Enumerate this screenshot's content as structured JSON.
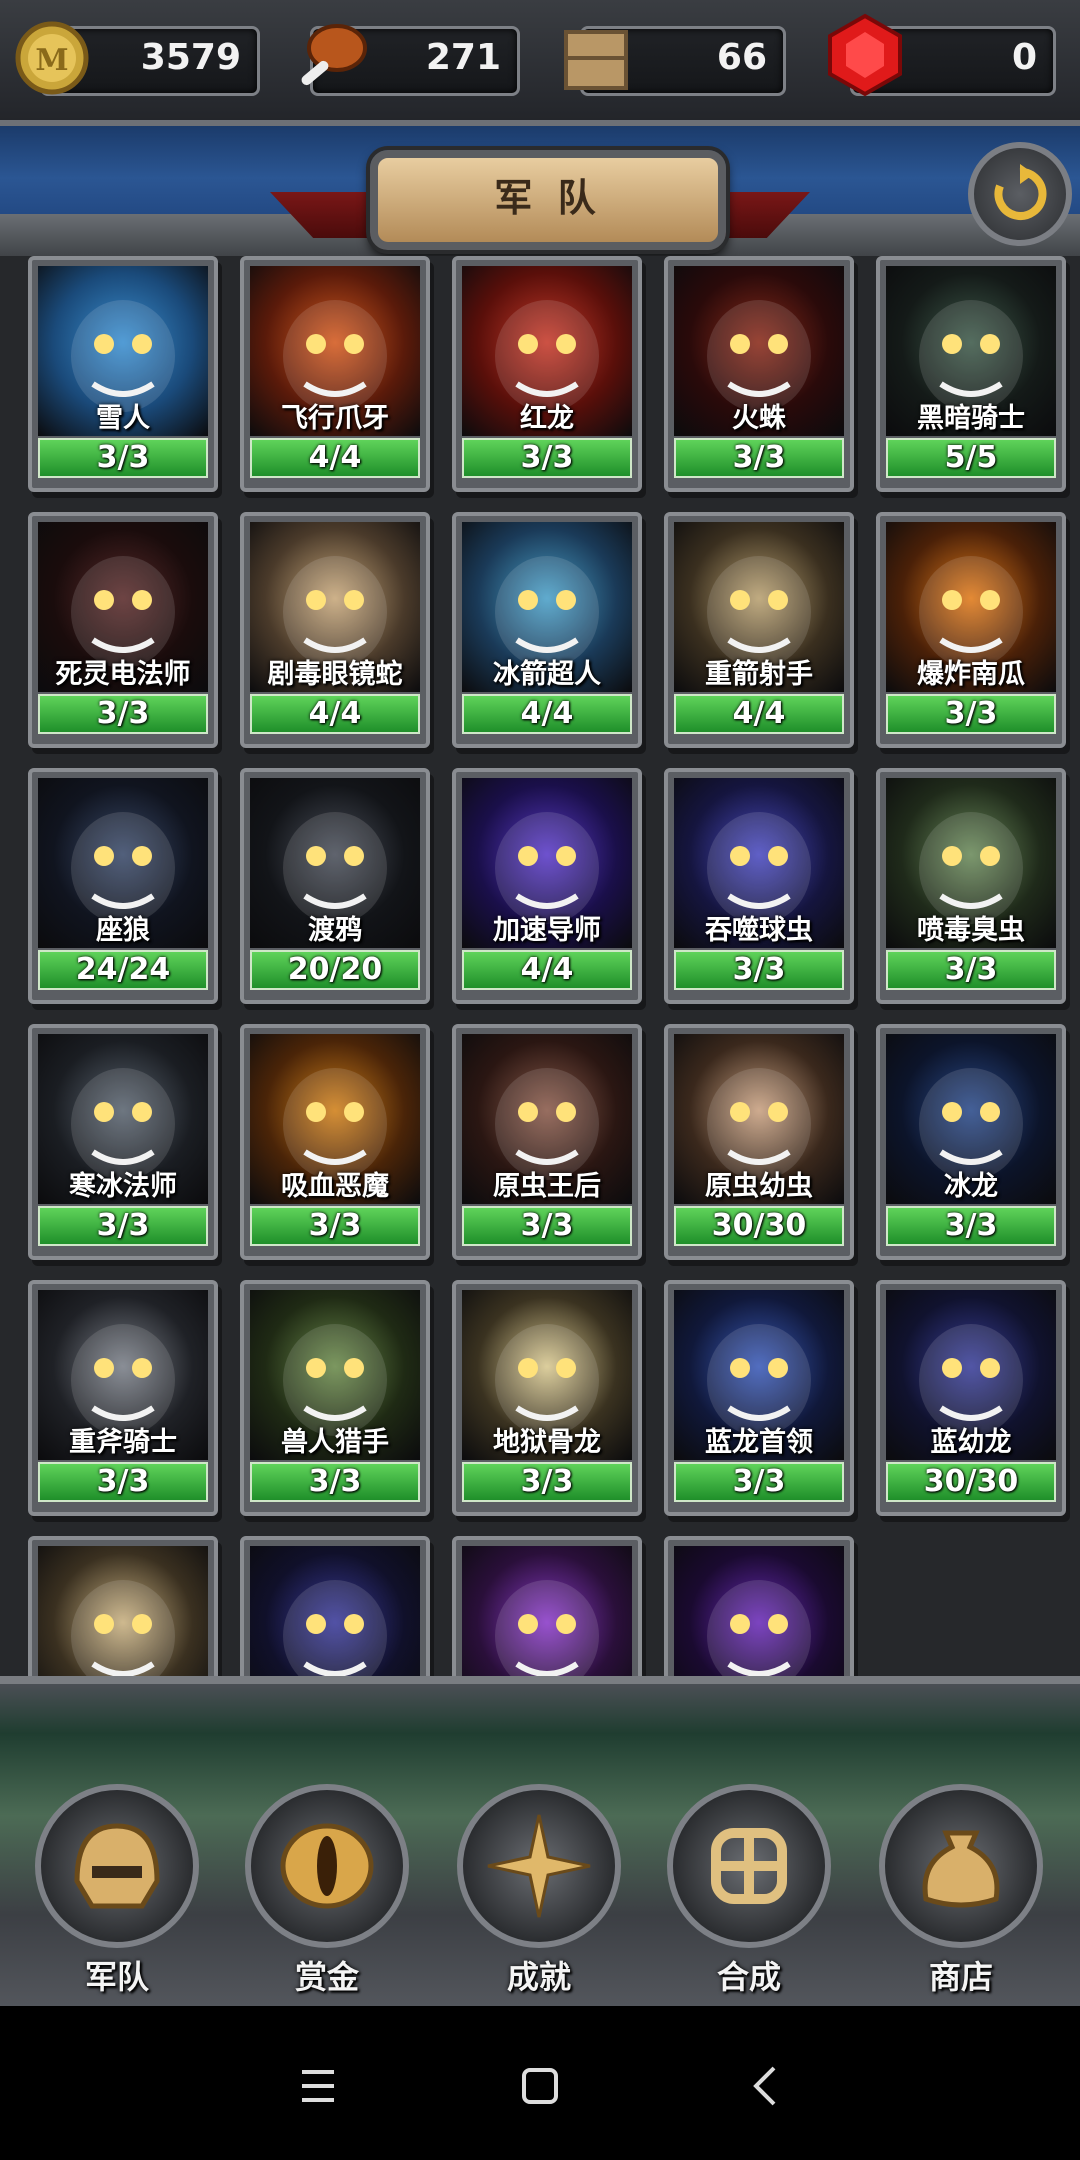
{
  "resources": {
    "gold": "3579",
    "food": "271",
    "crates": "66",
    "gems": "0"
  },
  "header": {
    "title": "军 队"
  },
  "units": [
    {
      "name": "雪人",
      "count": "3/3",
      "c1": "#3b8fd0",
      "c2": "#1a4a7a"
    },
    {
      "name": "飞行爪牙",
      "count": "4/4",
      "c1": "#d45a1f",
      "c2": "#5a1a0a"
    },
    {
      "name": "红龙",
      "count": "3/3",
      "c1": "#c63a2a",
      "c2": "#5a0f0a"
    },
    {
      "name": "火蛛",
      "count": "3/3",
      "c1": "#8a2a1a",
      "c2": "#2a0a0a"
    },
    {
      "name": "黑暗骑士",
      "count": "5/5",
      "c1": "#3e5a4a",
      "c2": "#141a18"
    },
    {
      "name": "死灵电法师",
      "count": "3/3",
      "c1": "#5a2a2a",
      "c2": "#1a0c0c"
    },
    {
      "name": "剧毒眼镜蛇",
      "count": "4/4",
      "c1": "#c7a77a",
      "c2": "#4a3a2a"
    },
    {
      "name": "冰箭超人",
      "count": "4/4",
      "c1": "#4aa0c8",
      "c2": "#1a3a58"
    },
    {
      "name": "重箭射手",
      "count": "4/4",
      "c1": "#b8a070",
      "c2": "#3a2f1f"
    },
    {
      "name": "爆炸南瓜",
      "count": "3/3",
      "c1": "#e07a1a",
      "c2": "#4a2008"
    },
    {
      "name": "座狼",
      "count": "24/24",
      "c1": "#3a4a6a",
      "c2": "#10141f"
    },
    {
      "name": "渡鸦",
      "count": "20/20",
      "c1": "#4a4f5a",
      "c2": "#121418"
    },
    {
      "name": "加速导师",
      "count": "4/4",
      "c1": "#5a3ac8",
      "c2": "#1a0f4a"
    },
    {
      "name": "吞噬球虫",
      "count": "3/3",
      "c1": "#4a4ac0",
      "c2": "#15153f"
    },
    {
      "name": "喷毒臭虫",
      "count": "3/3",
      "c1": "#6a8a5a",
      "c2": "#1f2a1a"
    },
    {
      "name": "寒冰法师",
      "count": "3/3",
      "c1": "#5a6470",
      "c2": "#1a1d22"
    },
    {
      "name": "吸血恶魔",
      "count": "3/3",
      "c1": "#d0801a",
      "c2": "#4a2408"
    },
    {
      "name": "原虫王后",
      "count": "3/3",
      "c1": "#8a5a4a",
      "c2": "#2a1612"
    },
    {
      "name": "原虫幼虫",
      "count": "30/30",
      "c1": "#c8a080",
      "c2": "#3a281c"
    },
    {
      "name": "冰龙",
      "count": "3/3",
      "c1": "#2a4a8a",
      "c2": "#0c142a"
    },
    {
      "name": "重斧骑士",
      "count": "3/3",
      "c1": "#7a7f88",
      "c2": "#1f2126"
    },
    {
      "name": "兽人猎手",
      "count": "3/3",
      "c1": "#6a8a4a",
      "c2": "#1f2a14"
    },
    {
      "name": "地狱骨龙",
      "count": "3/3",
      "c1": "#d8c890",
      "c2": "#3a3220"
    },
    {
      "name": "蓝龙首领",
      "count": "3/3",
      "c1": "#3a5ab8",
      "c2": "#10183a"
    },
    {
      "name": "蓝幼龙",
      "count": "30/30",
      "c1": "#3a3f9a",
      "c2": "#10122e"
    },
    {
      "name": "",
      "count": "",
      "c1": "#c8b080",
      "c2": "#3a3020"
    },
    {
      "name": "",
      "count": "",
      "c1": "#3a3a9a",
      "c2": "#10102a"
    },
    {
      "name": "",
      "count": "",
      "c1": "#8a3ac8",
      "c2": "#2a0f3a"
    },
    {
      "name": "",
      "count": "",
      "c1": "#6a2ab8",
      "c2": "#1a0a30"
    }
  ],
  "nav": {
    "items": [
      {
        "label": "军队"
      },
      {
        "label": "赏金"
      },
      {
        "label": "成就"
      },
      {
        "label": "合成"
      },
      {
        "label": "商店"
      }
    ]
  },
  "colors": {
    "count_bar": "#3cb34a",
    "accent": "#d9b06a"
  }
}
